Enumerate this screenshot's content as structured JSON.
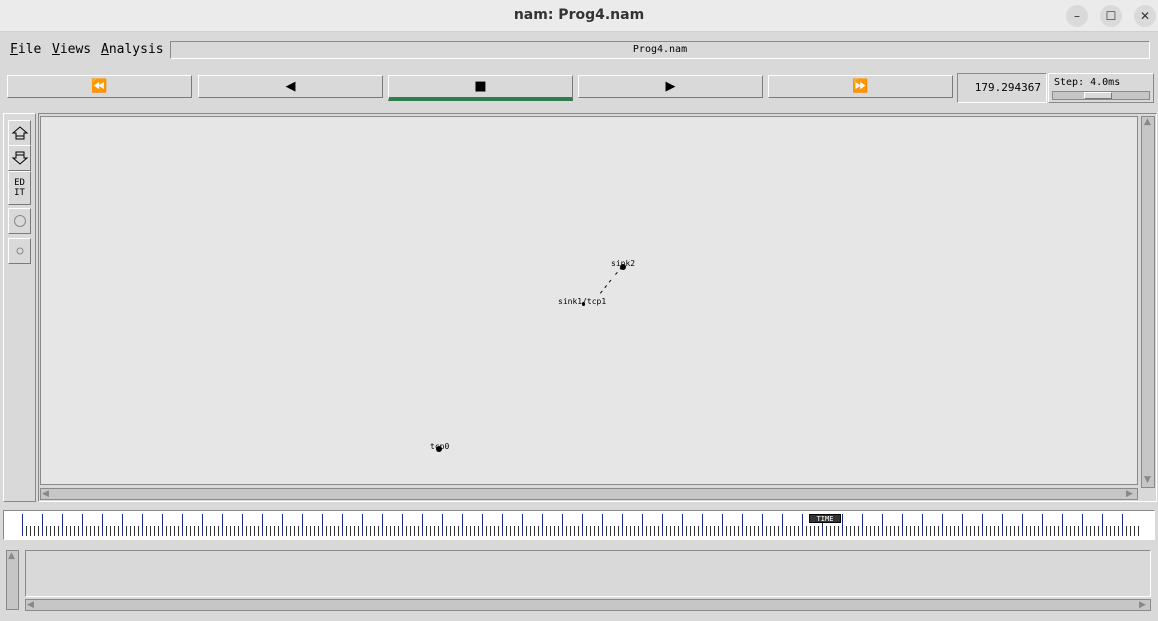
{
  "window": {
    "title": "nam: Prog4.nam",
    "minimize_icon": "minimize-icon",
    "maximize_icon": "maximize-icon",
    "close_icon": "close-icon"
  },
  "menu": {
    "file": {
      "mnemonic": "F",
      "rest": "ile"
    },
    "views": {
      "mnemonic": "V",
      "rest": "iews"
    },
    "analysis": {
      "mnemonic": "A",
      "rest": "nalysis"
    }
  },
  "file_name": "Prog4.nam",
  "toolbar": {
    "rewind_fast": "⏪",
    "rewind": "◀",
    "stop": "■",
    "play": "▶",
    "forward_fast": "⏩"
  },
  "time_display": "179.294367",
  "step": {
    "label": "Step: 4.0ms",
    "level_fraction": 0.46
  },
  "left_tools": {
    "zoom_in": "zoom-in-icon",
    "zoom_out": "zoom-out-icon",
    "edit": "ED\nIT",
    "circle_large": "circle-icon",
    "circle_small": "small-circle-icon"
  },
  "nodes": [
    {
      "label": "sink2"
    },
    {
      "label": "sink1/tcp1"
    },
    {
      "label": "tcp0"
    }
  ],
  "timeline": {
    "marker": "TIME"
  }
}
